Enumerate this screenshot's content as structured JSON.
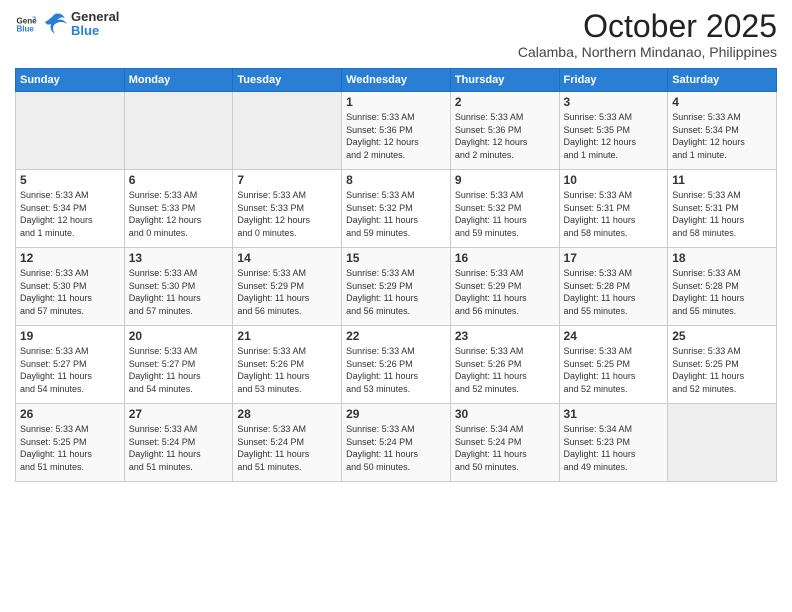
{
  "logo": {
    "general": "General",
    "blue": "Blue"
  },
  "header": {
    "month": "October 2025",
    "location": "Calamba, Northern Mindanao, Philippines"
  },
  "weekdays": [
    "Sunday",
    "Monday",
    "Tuesday",
    "Wednesday",
    "Thursday",
    "Friday",
    "Saturday"
  ],
  "weeks": [
    [
      {
        "day": "",
        "info": ""
      },
      {
        "day": "",
        "info": ""
      },
      {
        "day": "",
        "info": ""
      },
      {
        "day": "1",
        "info": "Sunrise: 5:33 AM\nSunset: 5:36 PM\nDaylight: 12 hours\nand 2 minutes."
      },
      {
        "day": "2",
        "info": "Sunrise: 5:33 AM\nSunset: 5:36 PM\nDaylight: 12 hours\nand 2 minutes."
      },
      {
        "day": "3",
        "info": "Sunrise: 5:33 AM\nSunset: 5:35 PM\nDaylight: 12 hours\nand 1 minute."
      },
      {
        "day": "4",
        "info": "Sunrise: 5:33 AM\nSunset: 5:34 PM\nDaylight: 12 hours\nand 1 minute."
      }
    ],
    [
      {
        "day": "5",
        "info": "Sunrise: 5:33 AM\nSunset: 5:34 PM\nDaylight: 12 hours\nand 1 minute."
      },
      {
        "day": "6",
        "info": "Sunrise: 5:33 AM\nSunset: 5:33 PM\nDaylight: 12 hours\nand 0 minutes."
      },
      {
        "day": "7",
        "info": "Sunrise: 5:33 AM\nSunset: 5:33 PM\nDaylight: 12 hours\nand 0 minutes."
      },
      {
        "day": "8",
        "info": "Sunrise: 5:33 AM\nSunset: 5:32 PM\nDaylight: 11 hours\nand 59 minutes."
      },
      {
        "day": "9",
        "info": "Sunrise: 5:33 AM\nSunset: 5:32 PM\nDaylight: 11 hours\nand 59 minutes."
      },
      {
        "day": "10",
        "info": "Sunrise: 5:33 AM\nSunset: 5:31 PM\nDaylight: 11 hours\nand 58 minutes."
      },
      {
        "day": "11",
        "info": "Sunrise: 5:33 AM\nSunset: 5:31 PM\nDaylight: 11 hours\nand 58 minutes."
      }
    ],
    [
      {
        "day": "12",
        "info": "Sunrise: 5:33 AM\nSunset: 5:30 PM\nDaylight: 11 hours\nand 57 minutes."
      },
      {
        "day": "13",
        "info": "Sunrise: 5:33 AM\nSunset: 5:30 PM\nDaylight: 11 hours\nand 57 minutes."
      },
      {
        "day": "14",
        "info": "Sunrise: 5:33 AM\nSunset: 5:29 PM\nDaylight: 11 hours\nand 56 minutes."
      },
      {
        "day": "15",
        "info": "Sunrise: 5:33 AM\nSunset: 5:29 PM\nDaylight: 11 hours\nand 56 minutes."
      },
      {
        "day": "16",
        "info": "Sunrise: 5:33 AM\nSunset: 5:29 PM\nDaylight: 11 hours\nand 56 minutes."
      },
      {
        "day": "17",
        "info": "Sunrise: 5:33 AM\nSunset: 5:28 PM\nDaylight: 11 hours\nand 55 minutes."
      },
      {
        "day": "18",
        "info": "Sunrise: 5:33 AM\nSunset: 5:28 PM\nDaylight: 11 hours\nand 55 minutes."
      }
    ],
    [
      {
        "day": "19",
        "info": "Sunrise: 5:33 AM\nSunset: 5:27 PM\nDaylight: 11 hours\nand 54 minutes."
      },
      {
        "day": "20",
        "info": "Sunrise: 5:33 AM\nSunset: 5:27 PM\nDaylight: 11 hours\nand 54 minutes."
      },
      {
        "day": "21",
        "info": "Sunrise: 5:33 AM\nSunset: 5:26 PM\nDaylight: 11 hours\nand 53 minutes."
      },
      {
        "day": "22",
        "info": "Sunrise: 5:33 AM\nSunset: 5:26 PM\nDaylight: 11 hours\nand 53 minutes."
      },
      {
        "day": "23",
        "info": "Sunrise: 5:33 AM\nSunset: 5:26 PM\nDaylight: 11 hours\nand 52 minutes."
      },
      {
        "day": "24",
        "info": "Sunrise: 5:33 AM\nSunset: 5:25 PM\nDaylight: 11 hours\nand 52 minutes."
      },
      {
        "day": "25",
        "info": "Sunrise: 5:33 AM\nSunset: 5:25 PM\nDaylight: 11 hours\nand 52 minutes."
      }
    ],
    [
      {
        "day": "26",
        "info": "Sunrise: 5:33 AM\nSunset: 5:25 PM\nDaylight: 11 hours\nand 51 minutes."
      },
      {
        "day": "27",
        "info": "Sunrise: 5:33 AM\nSunset: 5:24 PM\nDaylight: 11 hours\nand 51 minutes."
      },
      {
        "day": "28",
        "info": "Sunrise: 5:33 AM\nSunset: 5:24 PM\nDaylight: 11 hours\nand 51 minutes."
      },
      {
        "day": "29",
        "info": "Sunrise: 5:33 AM\nSunset: 5:24 PM\nDaylight: 11 hours\nand 50 minutes."
      },
      {
        "day": "30",
        "info": "Sunrise: 5:34 AM\nSunset: 5:24 PM\nDaylight: 11 hours\nand 50 minutes."
      },
      {
        "day": "31",
        "info": "Sunrise: 5:34 AM\nSunset: 5:23 PM\nDaylight: 11 hours\nand 49 minutes."
      },
      {
        "day": "",
        "info": ""
      }
    ]
  ]
}
